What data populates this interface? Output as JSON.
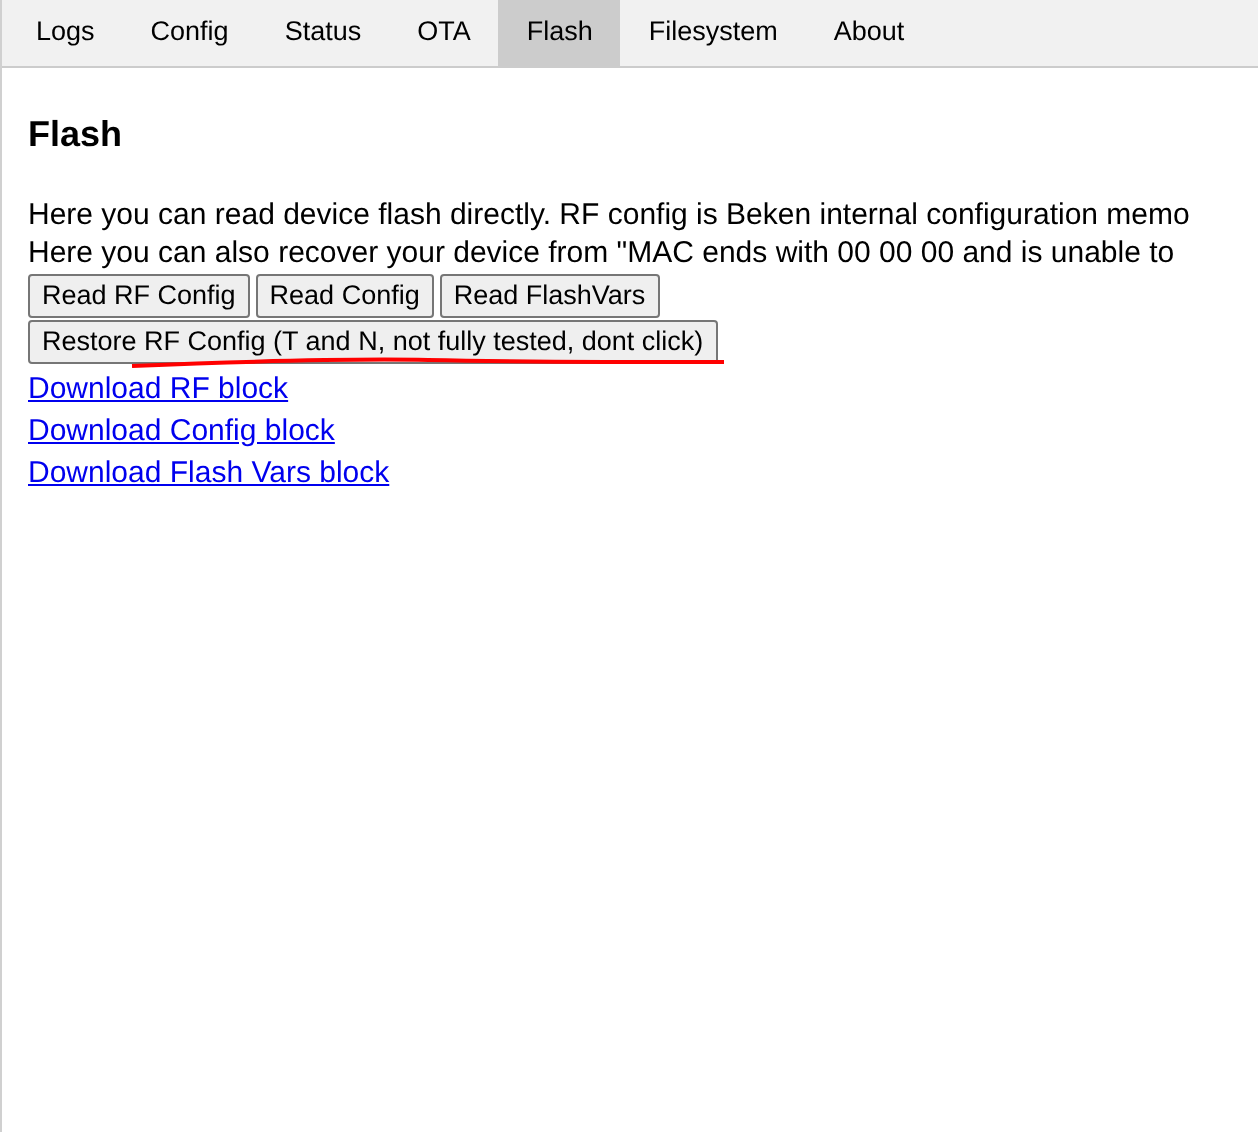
{
  "tabs": [
    {
      "label": "Logs",
      "selected": false
    },
    {
      "label": "Config",
      "selected": false
    },
    {
      "label": "Status",
      "selected": false
    },
    {
      "label": "OTA",
      "selected": false
    },
    {
      "label": "Flash",
      "selected": true
    },
    {
      "label": "Filesystem",
      "selected": false
    },
    {
      "label": "About",
      "selected": false
    }
  ],
  "heading": "Flash",
  "paragraphs": [
    "Here you can read device flash directly. RF config is Beken internal configuration memo",
    "Here you can also recover your device from \"MAC ends with 00 00 00 and is unable to"
  ],
  "button_rows": [
    [
      "Read RF Config",
      "Read Config",
      "Read FlashVars"
    ],
    [
      "Restore RF Config (T and N, not fully tested, dont click)"
    ]
  ],
  "links": [
    "Download RF block",
    "Download Config block",
    "Download Flash Vars block"
  ]
}
